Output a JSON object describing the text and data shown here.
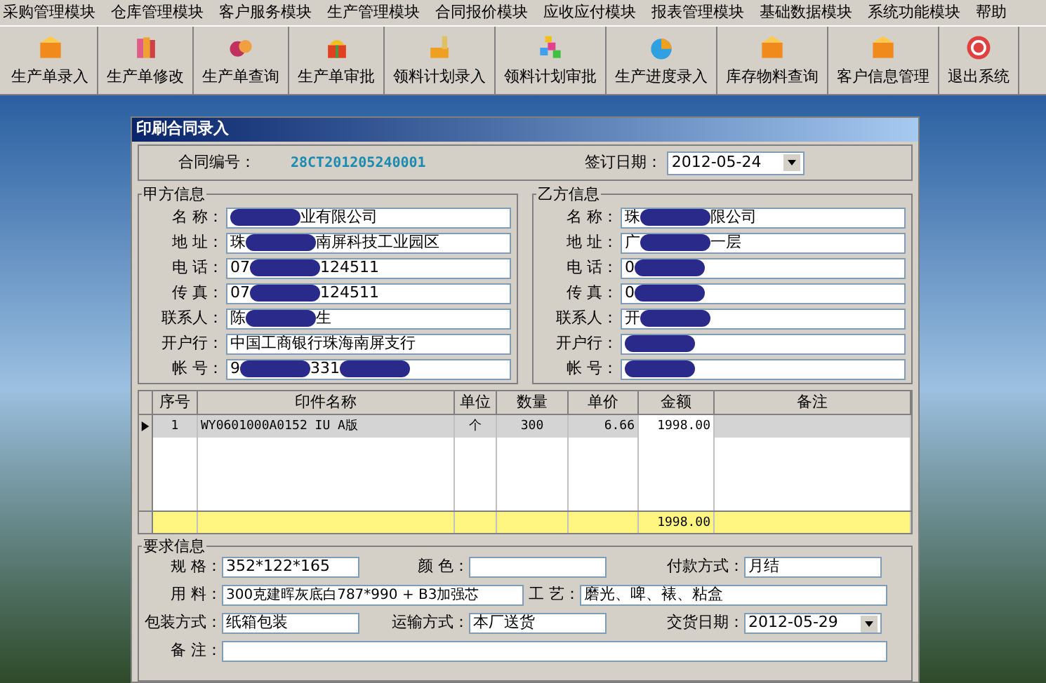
{
  "menu": [
    "采购管理模块",
    "仓库管理模块",
    "客户服务模块",
    "生产管理模块",
    "合同报价模块",
    "应收应付模块",
    "报表管理模块",
    "基础数据模块",
    "系统功能模块",
    "帮助"
  ],
  "toolbar": [
    {
      "label": "生产单录入",
      "kind": "box"
    },
    {
      "label": "生产单修改",
      "kind": "books"
    },
    {
      "label": "生产单查询",
      "kind": "balls"
    },
    {
      "label": "生产单审批",
      "kind": "gift"
    },
    {
      "label": "领料计划录入",
      "kind": "pen"
    },
    {
      "label": "领料计划审批",
      "kind": "blocks"
    },
    {
      "label": "生产进度录入",
      "kind": "pie"
    },
    {
      "label": "库存物料查询",
      "kind": "box"
    },
    {
      "label": "客户信息管理",
      "kind": "box"
    },
    {
      "label": "退出系统",
      "kind": "exit"
    }
  ],
  "dialog": {
    "title": "印刷合同录入",
    "contract_no_label": "合同编号：",
    "contract_no": "28CT201205240001",
    "sign_date_label": "签订日期：",
    "sign_date": "2012-05-24",
    "party_a": {
      "title": "甲方信息",
      "fields": [
        {
          "label": "名 称：",
          "parts": [
            {
              "kind": "redaction"
            },
            {
              "kind": "text",
              "text": "业有限公司"
            }
          ]
        },
        {
          "label": "地 址：",
          "parts": [
            {
              "kind": "text",
              "text": "珠"
            },
            {
              "kind": "redaction"
            },
            {
              "kind": "text",
              "text": "南屏科技工业园区"
            }
          ]
        },
        {
          "label": "电 话：",
          "parts": [
            {
              "kind": "text",
              "text": "07"
            },
            {
              "kind": "redaction"
            },
            {
              "kind": "text",
              "text": "124511"
            }
          ]
        },
        {
          "label": "传 真：",
          "parts": [
            {
              "kind": "text",
              "text": "07"
            },
            {
              "kind": "redaction"
            },
            {
              "kind": "text",
              "text": "124511"
            }
          ]
        },
        {
          "label": "联系人：",
          "parts": [
            {
              "kind": "text",
              "text": "陈"
            },
            {
              "kind": "redaction"
            },
            {
              "kind": "text",
              "text": "生"
            }
          ]
        },
        {
          "label": "开户行：",
          "parts": [
            {
              "kind": "text",
              "text": "中国工商银行珠海南屏支行"
            }
          ]
        },
        {
          "label": "帐 号：",
          "parts": [
            {
              "kind": "text",
              "text": "9"
            },
            {
              "kind": "redaction"
            },
            {
              "kind": "text",
              "text": "331"
            },
            {
              "kind": "redaction"
            }
          ]
        }
      ]
    },
    "party_b": {
      "title": "乙方信息",
      "fields": [
        {
          "label": "名 称：",
          "parts": [
            {
              "kind": "text",
              "text": "珠"
            },
            {
              "kind": "redaction"
            },
            {
              "kind": "text",
              "text": "限公司"
            }
          ]
        },
        {
          "label": "地 址：",
          "parts": [
            {
              "kind": "text",
              "text": "广"
            },
            {
              "kind": "redaction"
            },
            {
              "kind": "text",
              "text": "一层"
            }
          ]
        },
        {
          "label": "电 话：",
          "parts": [
            {
              "kind": "text",
              "text": "0"
            },
            {
              "kind": "redaction"
            }
          ]
        },
        {
          "label": "传 真：",
          "parts": [
            {
              "kind": "text",
              "text": "0"
            },
            {
              "kind": "redaction"
            }
          ]
        },
        {
          "label": "联系人：",
          "parts": [
            {
              "kind": "text",
              "text": "开"
            },
            {
              "kind": "redaction"
            }
          ]
        },
        {
          "label": "开户行：",
          "parts": [
            {
              "kind": "redaction"
            }
          ]
        },
        {
          "label": "帐 号：",
          "parts": [
            {
              "kind": "redaction"
            }
          ]
        }
      ]
    },
    "table": {
      "columns": [
        "序号",
        "印件名称",
        "单位",
        "数量",
        "单价",
        "金额",
        "备注"
      ],
      "rows": [
        {
          "selected": true,
          "cells": [
            "1",
            "WY0601000A0152  IU  A版",
            "个",
            "300",
            "6.66",
            "1998.00",
            ""
          ]
        }
      ],
      "total": "1998.00"
    },
    "requirements": {
      "title": "要求信息",
      "spec_label": "规 格：",
      "spec": "352*122*165",
      "color_label": "颜 色：",
      "payment_label": "付款方式：",
      "payment": "月结",
      "material_label": "用 料：",
      "material": "300克建晖灰底白787*990 + B3加强芯",
      "craft_label": "工 艺：",
      "craft": "磨光、啤、裱、粘盒",
      "packing_label": "包装方式：",
      "packing": "纸箱包装",
      "transport_label": "运输方式：",
      "transport": "本厂送货",
      "delivery_label": "交货日期：",
      "delivery": "2012-05-29",
      "note_label": "备 注："
    }
  }
}
